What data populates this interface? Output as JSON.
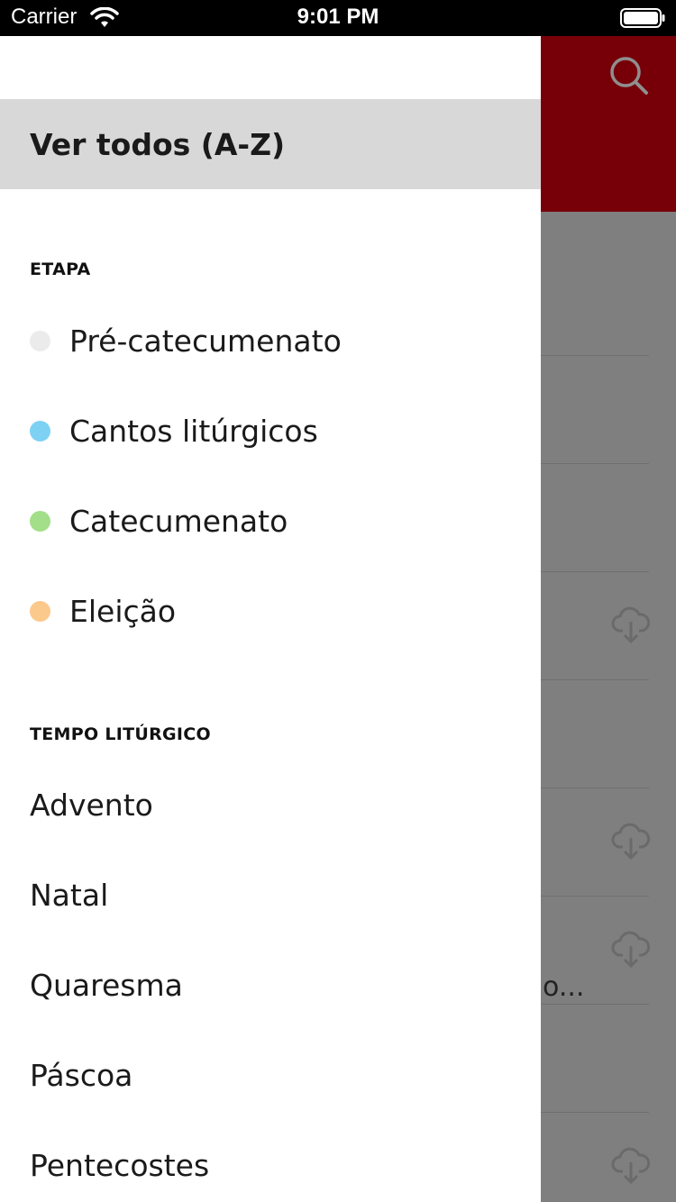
{
  "status_bar": {
    "carrier": "Carrier",
    "time": "9:01 PM"
  },
  "drawer": {
    "view_all": "Ver todos (A-Z)",
    "etapa": {
      "title": "ETAPA",
      "items": [
        {
          "label": "Pré-catecumenato",
          "color": "#ebebeb"
        },
        {
          "label": "Cantos litúrgicos",
          "color": "#7dd1f3"
        },
        {
          "label": "Catecumenato",
          "color": "#a2df88"
        },
        {
          "label": "Eleição",
          "color": "#fcc98c"
        }
      ]
    },
    "tempo": {
      "title": "TEMPO LITÚRGICO",
      "items": [
        {
          "label": "Advento"
        },
        {
          "label": "Natal"
        },
        {
          "label": "Quaresma"
        },
        {
          "label": "Páscoa"
        },
        {
          "label": "Pentecostes"
        }
      ]
    }
  },
  "background": {
    "header_color": "#770008",
    "partial_text": "o..."
  }
}
